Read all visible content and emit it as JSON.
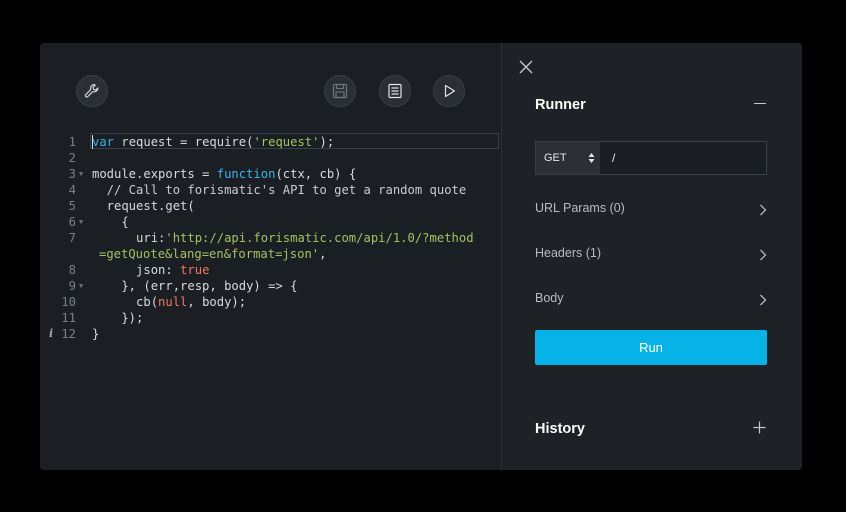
{
  "editor": {
    "toolbar": {
      "settings": "wrench-icon",
      "save": "floppy-disk-icon",
      "format": "document-lines-icon",
      "run": "play-icon"
    },
    "lines": [
      {
        "num": "1"
      },
      {
        "num": "2"
      },
      {
        "num": "3"
      },
      {
        "num": "4"
      },
      {
        "num": "5"
      },
      {
        "num": "6"
      },
      {
        "num": "7"
      },
      {
        "num": ""
      },
      {
        "num": "8"
      },
      {
        "num": "9"
      },
      {
        "num": "10"
      },
      {
        "num": "11"
      },
      {
        "num": "12"
      }
    ],
    "code": {
      "l1_a": "var",
      "l1_b": " request = require(",
      "l1_c": "'request'",
      "l1_d": ");",
      "l3_a": "module.exports = ",
      "l3_b": "function",
      "l3_c": "(ctx, cb) {",
      "l4": "  // Call to forismatic's API to get a random quote",
      "l5": "  request.get(",
      "l6": "    {",
      "l7_a": "      uri:",
      "l7_b": "'http://api.forismatic.com/api/1.0/?method",
      "l7w": "=getQuote&lang=en&format=json'",
      "l7w_b": ",",
      "l8_a": "      json: ",
      "l8_b": "true",
      "l9": "    }, (err,resp, body) => {",
      "l10_a": "      cb(",
      "l10_b": "null",
      "l10_c": ", body);",
      "l11": "    });",
      "l12": "}"
    },
    "info_marker": "i"
  },
  "runner": {
    "title": "Runner",
    "method": "GET",
    "path": "/",
    "sections": [
      {
        "label": "URL Params (0)"
      },
      {
        "label": "Headers (1)"
      },
      {
        "label": "Body"
      }
    ],
    "run_label": "Run",
    "history_title": "History"
  },
  "colors": {
    "accent": "#06b2e6",
    "keyword": "#39b5ea",
    "string": "#a5c261",
    "literal": "#f07a5f"
  }
}
